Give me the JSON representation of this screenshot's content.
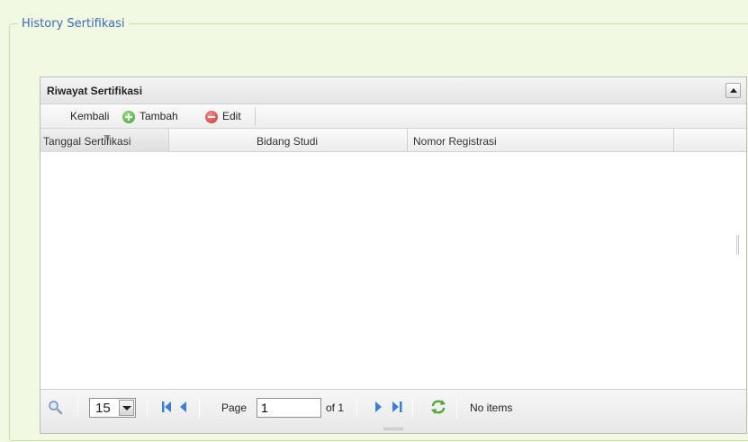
{
  "fieldset": {
    "legend": "History Sertifikasi"
  },
  "panel": {
    "title": "Riwayat Sertifikasi",
    "collapse_icon": "triangle-up-icon"
  },
  "toolbar": {
    "back_label": "Kembali",
    "add_label": "Tambah",
    "add_icon": "green-plus-circle-icon",
    "edit_label": "Edit",
    "edit_icon": "red-minus-circle-icon"
  },
  "columns": [
    {
      "label": "Tanggal Sertifikasi",
      "sorted": true
    },
    {
      "label": "Bidang Studi",
      "sorted": false
    },
    {
      "label": "Nomor Registrasi",
      "sorted": false
    }
  ],
  "rows": [],
  "pager": {
    "search_icon": "magnifier-icon",
    "page_size": "15",
    "page_label": "Page",
    "page_value": "1",
    "of_label": "of 1",
    "status": "No items",
    "colors": {
      "nav_icon": "#3b7fd4",
      "refresh_icon": "#55a83a"
    }
  }
}
